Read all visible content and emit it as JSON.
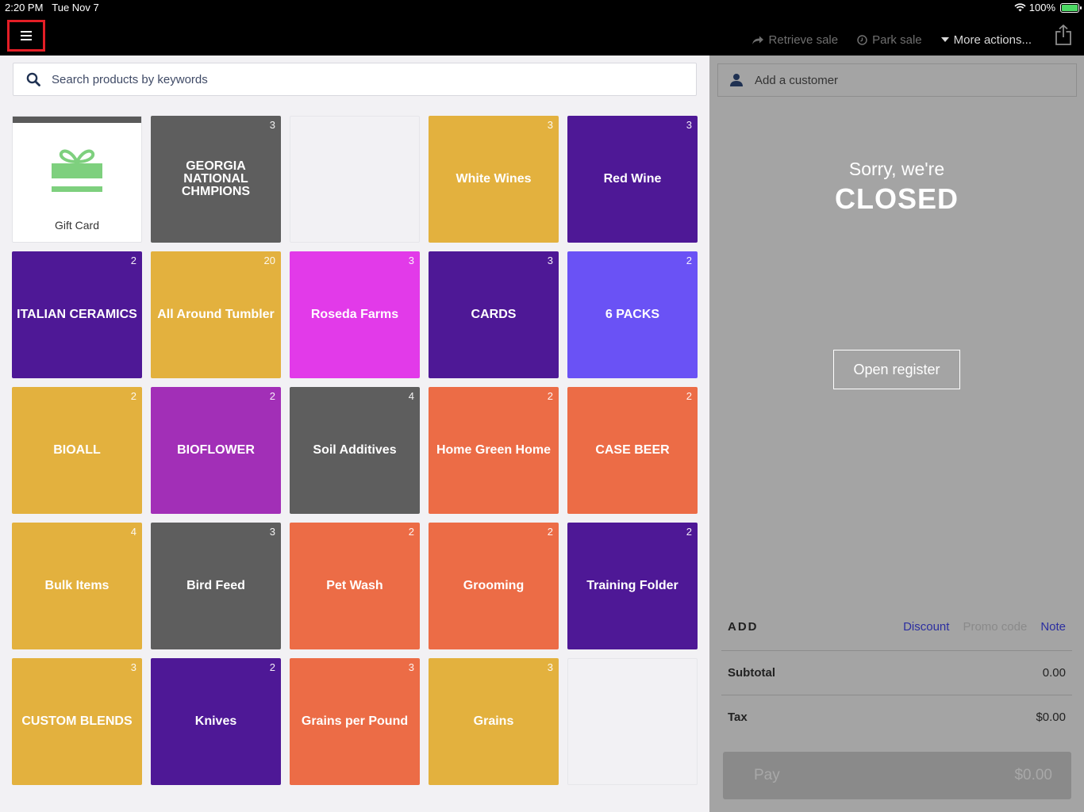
{
  "status_bar": {
    "time": "2:20 PM",
    "date": "Tue Nov 7",
    "battery": "100%",
    "battery_level": 1.0
  },
  "header": {
    "menu_icon": "hamburger-icon",
    "actions": [
      {
        "label": "Retrieve sale",
        "icon": "share-arrow-icon"
      },
      {
        "label": "Park sale",
        "icon": "clock-icon"
      },
      {
        "label": "More actions...",
        "icon": "caret-down-icon"
      }
    ],
    "share_icon": "share-icon"
  },
  "search": {
    "placeholder": "Search products by keywords",
    "icon": "search-icon"
  },
  "tiles": [
    {
      "label": "Gift Card",
      "count": "",
      "color": "#ffffff",
      "type": "gift"
    },
    {
      "label": "GEORGIA NATIONAL CHMPIONS",
      "count": "3",
      "color": "#5e5e5e"
    },
    {
      "label": "",
      "count": "",
      "color": "#f2f1f4",
      "type": "empty"
    },
    {
      "label": "White Wines",
      "count": "3",
      "color": "#e3b13e"
    },
    {
      "label": "Red Wine",
      "count": "3",
      "color": "#4e1896"
    },
    {
      "label": "ITALIAN CERAMICS",
      "count": "2",
      "color": "#4e1896"
    },
    {
      "label": "All Around Tumbler",
      "count": "20",
      "color": "#e3b13e"
    },
    {
      "label": "Roseda Farms",
      "count": "3",
      "color": "#e23ae9"
    },
    {
      "label": "CARDS",
      "count": "3",
      "color": "#4e1896"
    },
    {
      "label": "6 PACKS",
      "count": "2",
      "color": "#6a52f5"
    },
    {
      "label": "BIOALL",
      "count": "2",
      "color": "#e3b13e"
    },
    {
      "label": "BIOFLOWER",
      "count": "2",
      "color": "#a22fb7"
    },
    {
      "label": "Soil Additives",
      "count": "4",
      "color": "#5e5e5e"
    },
    {
      "label": "Home Green Home",
      "count": "2",
      "color": "#ec6c46"
    },
    {
      "label": "CASE BEER",
      "count": "2",
      "color": "#ec6c46"
    },
    {
      "label": "Bulk Items",
      "count": "4",
      "color": "#e3b13e"
    },
    {
      "label": "Bird Feed",
      "count": "3",
      "color": "#5e5e5e"
    },
    {
      "label": "Pet Wash",
      "count": "2",
      "color": "#ec6c46"
    },
    {
      "label": "Grooming",
      "count": "2",
      "color": "#ec6c46"
    },
    {
      "label": "Training Folder",
      "count": "2",
      "color": "#4e1896"
    },
    {
      "label": "CUSTOM BLENDS",
      "count": "3",
      "color": "#e3b13e"
    },
    {
      "label": "Knives",
      "count": "2",
      "color": "#4e1896"
    },
    {
      "label": "Grains per Pound",
      "count": "3",
      "color": "#ec6c46"
    },
    {
      "label": "Grains",
      "count": "3",
      "color": "#e3b13e"
    },
    {
      "label": "",
      "count": "",
      "color": "#f2f1f4",
      "type": "empty"
    }
  ],
  "customer": {
    "label": "Add a customer",
    "icon": "person-icon"
  },
  "closed": {
    "sorry": "Sorry, we're",
    "word": "CLOSED"
  },
  "open_register": {
    "label": "Open register"
  },
  "add_section": {
    "label": "ADD",
    "discount": "Discount",
    "promo": "Promo code",
    "note": "Note"
  },
  "totals": {
    "subtotal_label": "Subtotal",
    "subtotal_value": "0.00",
    "tax_label": "Tax",
    "tax_value": "$0.00"
  },
  "pay": {
    "label": "Pay",
    "amount": "$0.00"
  },
  "colors": {
    "accent": "#2b2ea0",
    "menu_highlight": "#e41e26",
    "gift_icon": "#7ed07e"
  }
}
